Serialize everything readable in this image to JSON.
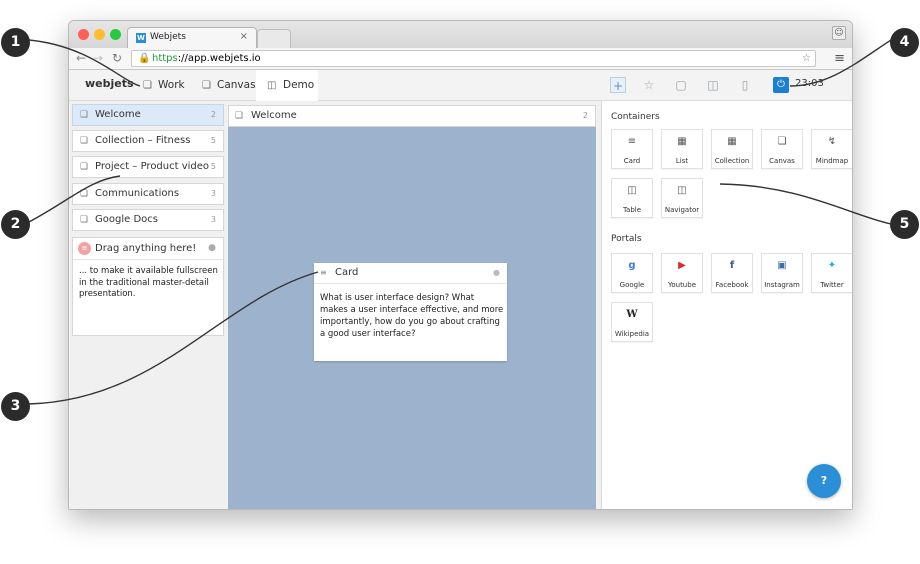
{
  "browser": {
    "tab_title": "Webjets",
    "tab_close": "×",
    "favicon_letter": "W",
    "url_scheme": "https",
    "url_rest": "://app.webjets.io"
  },
  "app": {
    "logo": "webjets",
    "tabs": [
      {
        "label": "Work",
        "icon": "canvas-icon"
      },
      {
        "label": "Canvas",
        "icon": "canvas-icon"
      },
      {
        "label": "Demo",
        "icon": "navigator-icon"
      }
    ],
    "time": "23:03"
  },
  "left_list": [
    {
      "label": "Welcome",
      "count": "2"
    },
    {
      "label": "Collection – Fitness",
      "count": "5"
    },
    {
      "label": "Project – Product video",
      "count": "5"
    },
    {
      "label": "Communications",
      "count": "3"
    },
    {
      "label": "Google Docs",
      "count": "3"
    }
  ],
  "drag_card": {
    "title": "Drag anything here!",
    "body": "... to make it available fullscreen in the traditional master-detail presentation."
  },
  "middle": {
    "title": "Welcome",
    "count": "2"
  },
  "card": {
    "title": "Card",
    "body": "What is user interface design? What makes a user interface effective, and more importantly, how do you go about crafting a good user interface?"
  },
  "panel": {
    "containers_title": "Containers",
    "containers": [
      {
        "label": "Card",
        "icon": "card-icon"
      },
      {
        "label": "List",
        "icon": "list-icon"
      },
      {
        "label": "Collection",
        "icon": "collection-icon"
      },
      {
        "label": "Canvas",
        "icon": "canvas-icon"
      },
      {
        "label": "Mindmap",
        "icon": "mindmap-icon"
      },
      {
        "label": "Table",
        "icon": "table-icon"
      },
      {
        "label": "Navigator",
        "icon": "navigator-icon"
      }
    ],
    "portals_title": "Portals",
    "portals": [
      {
        "label": "Google",
        "icon": "google-icon",
        "color": "#3b7de0"
      },
      {
        "label": "Youtube",
        "icon": "youtube-icon",
        "color": "#e02a2a"
      },
      {
        "label": "Facebook",
        "icon": "facebook-icon",
        "color": "#3b5998"
      },
      {
        "label": "Instagram",
        "icon": "instagram-icon",
        "color": "#3f6b99"
      },
      {
        "label": "Twitter",
        "icon": "twitter-icon",
        "color": "#2aa3ef"
      },
      {
        "label": "Wikipedia",
        "icon": "wikipedia-icon",
        "color": "#222222"
      }
    ]
  },
  "callouts": [
    "1",
    "2",
    "3",
    "4",
    "5"
  ],
  "colors": {
    "accent": "#2a8fd6",
    "canvas_bg": "#9db3cd",
    "selected_item": "#dce9f8"
  }
}
